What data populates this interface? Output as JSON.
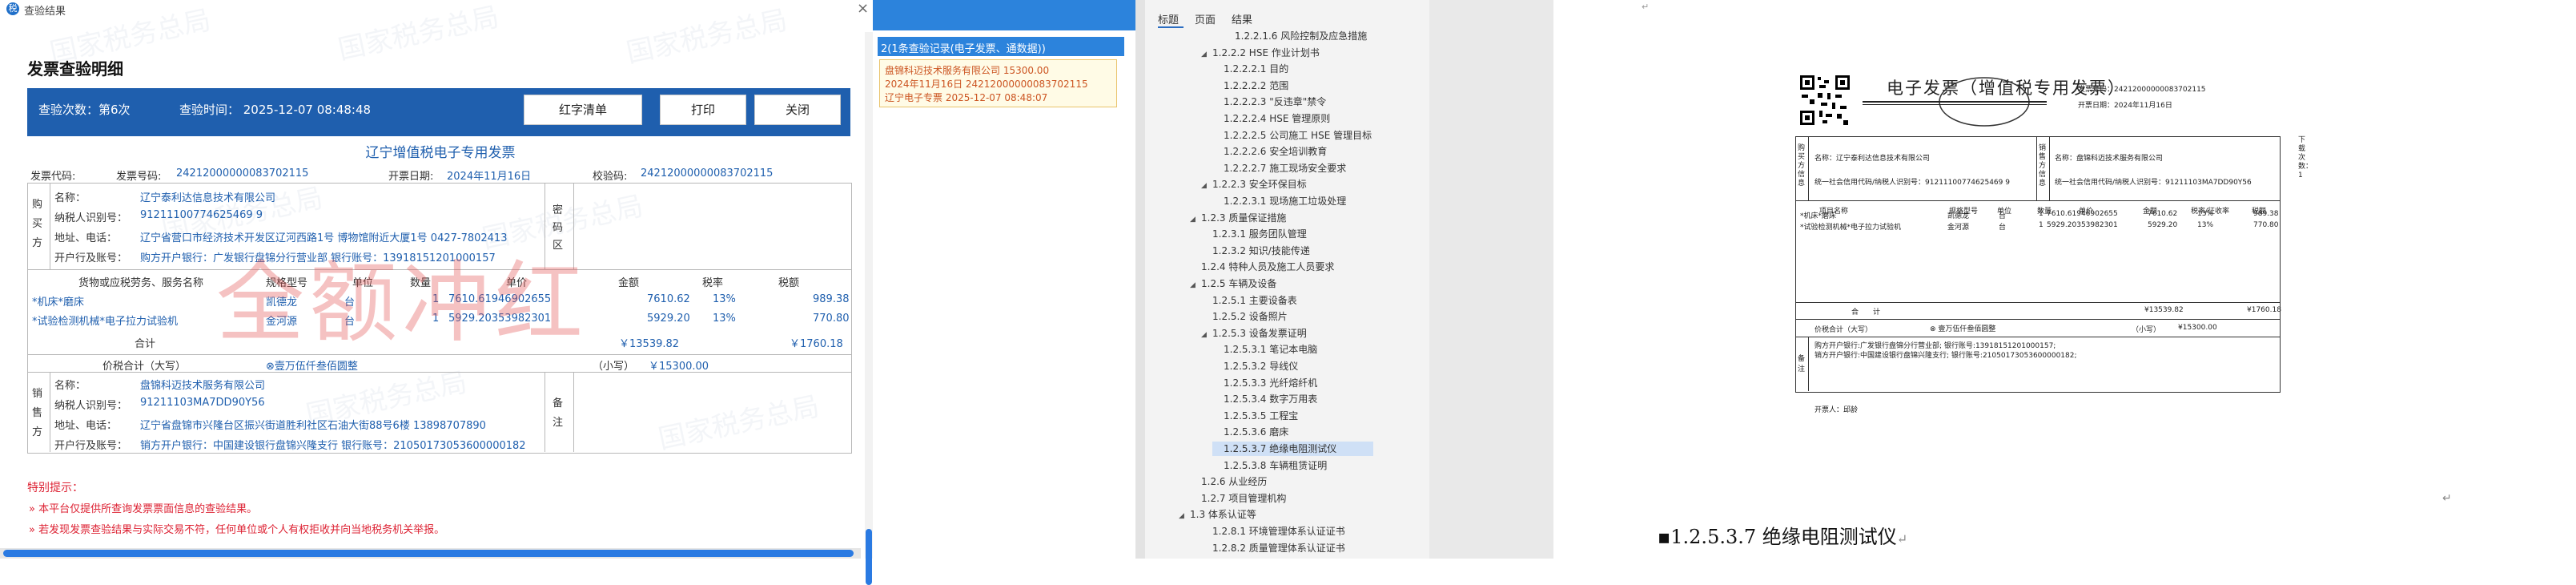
{
  "dialog": {
    "window_title": "查验结果",
    "heading": "发票查验明细",
    "watermark_text": "国家税务总局",
    "check_count": "查验次数：第6次",
    "check_time": "查验时间：  2025-12-07 08:48:48",
    "btn_red_list": "红字清单",
    "btn_print": "打印",
    "btn_close": "关闭",
    "invoice_title": "辽宁增值税电子专用发票",
    "code_label": "发票代码:",
    "number_label": "发票号码:",
    "number_value": "24212000000083702115",
    "date_label": "开票日期:",
    "date_value": "2024年11月16日",
    "checkcode_label": "校验码:",
    "checkcode_value": "24212000000083702115",
    "buyer_side": "购买方",
    "buyer_name_label": "名称：",
    "buyer_name": "辽宁泰利达信息技术有限公司",
    "buyer_tax_label": "纳税人识别号：",
    "buyer_tax": "91211100774625469 9",
    "buyer_addr_label": "地址、电话：",
    "buyer_addr": "辽宁省营口市经济技术开发区辽河西路1号 博物馆附近大厦1号 0427-7802413",
    "buyer_bank_label": "开户行及账号：",
    "buyer_bank": "购方开户银行：广发银行盘锦分行营业部 银行账号：13918151201000157",
    "secret_area": "密码区",
    "col_name": "货物或应税劳务、服务名称",
    "col_spec": "规格型号",
    "col_unit": "单位",
    "col_qty": "数量",
    "col_price": "单价",
    "col_amount": "金额",
    "col_rate": "税率",
    "col_tax": "税额",
    "items": [
      {
        "name": "*机床*磨床",
        "spec": "凯德龙",
        "unit": "台",
        "qty": "1",
        "price": "7610.61946902655",
        "amount": "7610.62",
        "rate": "13%",
        "tax": "989.38"
      },
      {
        "name": "*试验检测机械*电子拉力试验机",
        "spec": "金河源",
        "unit": "台",
        "qty": "1",
        "price": "5929.20353982301",
        "amount": "5929.20",
        "rate": "13%",
        "tax": "770.80"
      }
    ],
    "total_label": "合计",
    "total_amount": "￥13539.82",
    "total_tax": "￥1760.18",
    "grand_label": "价税合计（大写）",
    "grand_upper": "⊗壹万伍仟叁佰圆整",
    "grand_small_label": "（小写）",
    "grand_small": "￥15300.00",
    "seller_side": "销售方",
    "seller_name_label": "名称：",
    "seller_name": "盘锦科迈技术服务有限公司",
    "seller_tax_label": "纳税人识别号：",
    "seller_tax": "91211103MA7DD90Y56",
    "seller_addr_label": "地址、电话：",
    "seller_addr": "辽宁省盘锦市兴隆台区振兴街道胜利社区石油大街88号6楼 13898707890",
    "seller_bank_label": "开户行及账号：",
    "seller_bank": "销方开户银行：中国建设银行盘锦兴隆支行 银行账号：21050173053600000182",
    "remark": "备注",
    "stamp": "全额冲红",
    "tips_title": "特别提示：",
    "tip1": "本平台仅提供所查询发票票面信息的查验结果。",
    "tip2": "若发现发票查验结果与实际交易不符，任何单位或个人有权拒收并向当地税务机关举报。"
  },
  "middle": {
    "selected_row": "2(1条查验记录(电子发票、通数据))",
    "tip_lines": [
      "盘锦科迈技术服务有限公司 15300.00",
      "2024年11月16日  24212000000083702115",
      "辽宁电子专票 2025-12-07 08:48:07"
    ]
  },
  "nav": {
    "tabs": [
      "标题",
      "页面",
      "结果"
    ],
    "items": [
      {
        "text": "1.2.2.1.6 风险控制及应急措施",
        "indent": 3,
        "tri": ""
      },
      {
        "text": "1.2.2.2 HSE 作业计划书",
        "indent": 1,
        "tri": "◢"
      },
      {
        "text": "1.2.2.2.1 目的",
        "indent": 2,
        "tri": ""
      },
      {
        "text": "1.2.2.2.2 范围",
        "indent": 2,
        "tri": ""
      },
      {
        "text": "1.2.2.2.3 \"反违章\"禁令",
        "indent": 2,
        "tri": ""
      },
      {
        "text": "1.2.2.2.4 HSE 管理原则",
        "indent": 2,
        "tri": ""
      },
      {
        "text": "1.2.2.2.5 公司施工 HSE 管理目标",
        "indent": 2,
        "tri": ""
      },
      {
        "text": "1.2.2.2.6 安全培训教育",
        "indent": 2,
        "tri": ""
      },
      {
        "text": "1.2.2.2.7 施工现场安全要求",
        "indent": 2,
        "tri": ""
      },
      {
        "text": "1.2.2.3 安全环保目标",
        "indent": 1,
        "tri": "◢"
      },
      {
        "text": "1.2.2.3.1 现场施工垃圾处理",
        "indent": 2,
        "tri": ""
      },
      {
        "text": "1.2.3 质量保证措施",
        "indent": 0,
        "tri": "◢"
      },
      {
        "text": "1.2.3.1 服务团队管理",
        "indent": 1,
        "tri": ""
      },
      {
        "text": "1.2.3.2 知识/技能传递",
        "indent": 1,
        "tri": ""
      },
      {
        "text": "1.2.4 特种人员及施工人员要求",
        "indent": 0,
        "tri": ""
      },
      {
        "text": "1.2.5 车辆及设备",
        "indent": 0,
        "tri": "◢"
      },
      {
        "text": "1.2.5.1 主要设备表",
        "indent": 1,
        "tri": ""
      },
      {
        "text": "1.2.5.2 设备照片",
        "indent": 1,
        "tri": ""
      },
      {
        "text": "1.2.5.3 设备发票证明",
        "indent": 1,
        "tri": "◢"
      },
      {
        "text": "1.2.5.3.1 笔记本电脑",
        "indent": 2,
        "tri": ""
      },
      {
        "text": "1.2.5.3.2 导线仪",
        "indent": 2,
        "tri": ""
      },
      {
        "text": "1.2.5.3.3 光纤熔纤机",
        "indent": 2,
        "tri": ""
      },
      {
        "text": "1.2.5.3.4 数字万用表",
        "indent": 2,
        "tri": ""
      },
      {
        "text": "1.2.5.3.5 工程宝",
        "indent": 2,
        "tri": ""
      },
      {
        "text": "1.2.5.3.6 磨床",
        "indent": 2,
        "tri": ""
      },
      {
        "text": "1.2.5.3.7 绝缘电阻测试仪",
        "indent": 2,
        "tri": "",
        "selected": true
      },
      {
        "text": "1.2.5.3.8 车辆租赁证明",
        "indent": 2,
        "tri": ""
      },
      {
        "text": "1.2.6 从业经历",
        "indent": 0,
        "tri": ""
      },
      {
        "text": "1.2.7 项目管理机构",
        "indent": 0,
        "tri": ""
      },
      {
        "text": "1.3 体系认证等",
        "indent": -1,
        "tri": "◢"
      },
      {
        "text": "1.2.8.1 环境管理体系认证证书",
        "indent": 1,
        "tri": ""
      },
      {
        "text": "1.2.8.2 质量管理体系认证证书",
        "indent": 1,
        "tri": ""
      }
    ]
  },
  "doc": {
    "title": "电子发票（增值税专用发票）",
    "num_label": "发票号码：",
    "num_value": "24212000000083702115",
    "date_label": "开票日期：",
    "date_value": "2024年11月16日",
    "buyer_col": "购买方信息",
    "seller_col": "销售方信息",
    "buyer_name": "名称：辽宁泰利达信息技术有限公司",
    "buyer_tax": "统一社会信用代码/纳税人识别号：91211100774625469 9",
    "seller_name": "名称：盘锦科迈技术服务有限公司",
    "seller_tax": "统一社会信用代码/纳税人识别号：91211103MA7DD90Y56",
    "head_cols": [
      "项目名称",
      "规格型号",
      "单位",
      "数量",
      "单价",
      "金额",
      "税率/征收率",
      "税额"
    ],
    "rows": [
      [
        "*机床*磨床",
        "凯德龙",
        "台",
        "1",
        "7610.61946902655",
        "7610.62",
        "13%",
        "989.38"
      ],
      [
        "*试验检测机械*电子拉力试验机",
        "金河源",
        "台",
        "1",
        "5929.20353982301",
        "5929.20",
        "13%",
        "770.80"
      ]
    ],
    "sum_label": "合　　计",
    "sum_amount": "¥13539.82",
    "sum_tax": "¥1760.18",
    "total_upper_label": "价税合计（大写）",
    "total_upper": "壹万伍仟叁佰圆整",
    "total_small_label": "（小写）",
    "total_small": "¥15300.00",
    "remark_label": "备注",
    "remark_lines": [
      "购方开户银行:广发银行盘锦分行营业部; 银行账号:13918151201000157;",
      "销方开户银行:中国建设银行盘锦兴隆支行; 银行账号:21050173053600000182;"
    ],
    "issuer": "开票人：邱龄",
    "side_text": "下载次数：1",
    "heading": "1.2.5.3.7  绝缘电阻测试仪"
  }
}
